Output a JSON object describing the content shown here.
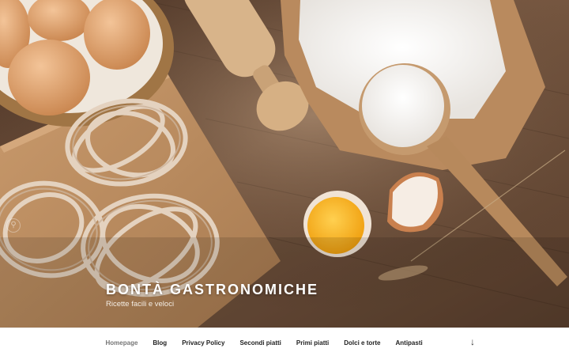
{
  "site": {
    "title": "BONTÀ GASTRONOMICHE",
    "description": "Ricette facili e veloci"
  },
  "navigation": {
    "items": [
      {
        "label": "Homepage",
        "current": true
      },
      {
        "label": "Blog"
      },
      {
        "label": "Privacy Policy"
      },
      {
        "label": "Secondi piatti"
      },
      {
        "label": "Primi piatti"
      },
      {
        "label": "Dolci e torte"
      },
      {
        "label": "Antipasti"
      }
    ],
    "scroll_icon": "arrow-down-icon"
  },
  "hero": {
    "image": "flour-eggs-pasta-header-image",
    "search_icon": "search-icon"
  },
  "colors": {
    "wood": "#6e5039",
    "nav_bg": "#ffffff",
    "nav_text": "#222222",
    "nav_current": "#767676",
    "title": "#ffffff"
  }
}
